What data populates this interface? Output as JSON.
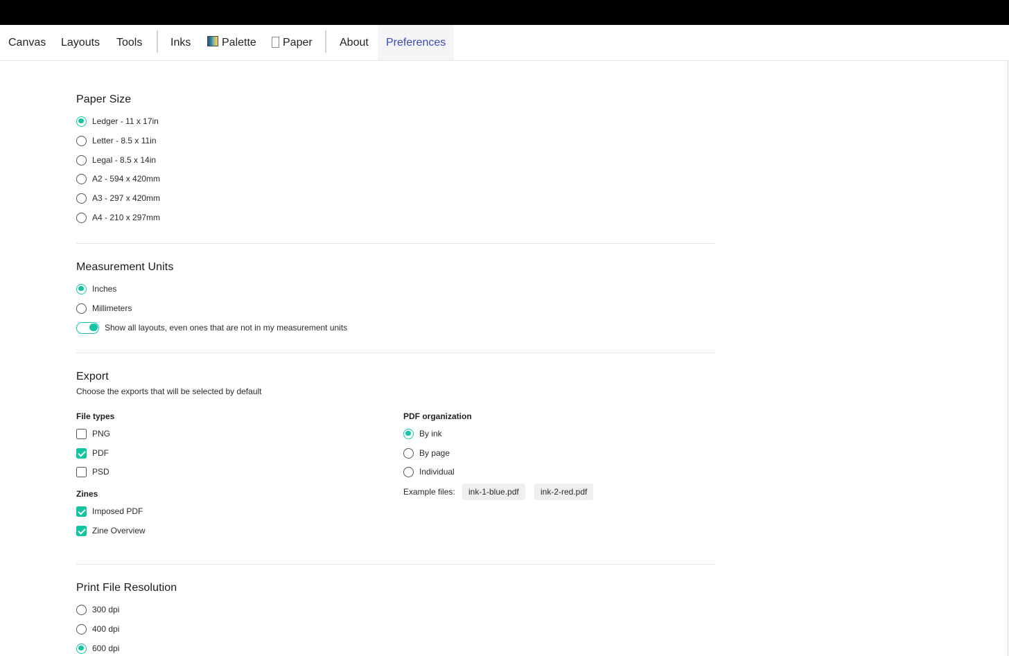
{
  "nav": {
    "items": [
      {
        "label": "Canvas"
      },
      {
        "label": "Layouts"
      },
      {
        "label": "Tools"
      },
      {
        "label": "Inks"
      },
      {
        "label": "Palette"
      },
      {
        "label": "Paper"
      },
      {
        "label": "About"
      },
      {
        "label": "Preferences",
        "active": true
      }
    ]
  },
  "paper_size": {
    "title": "Paper Size",
    "options": [
      {
        "label": "Ledger - 11 x 17in",
        "selected": true
      },
      {
        "label": "Letter - 8.5 x 11in",
        "selected": false
      },
      {
        "label": "Legal - 8.5 x 14in",
        "selected": false
      },
      {
        "label": "A2 - 594 x 420mm",
        "selected": false
      },
      {
        "label": "A3 - 297 x 420mm",
        "selected": false
      },
      {
        "label": "A4 - 210 x 297mm",
        "selected": false
      }
    ]
  },
  "measurement_units": {
    "title": "Measurement Units",
    "options": [
      {
        "label": "Inches",
        "selected": true
      },
      {
        "label": "Millimeters",
        "selected": false
      }
    ],
    "show_all_toggle": {
      "label": "Show all layouts, even ones that are not in my measurement units",
      "on": true
    }
  },
  "export": {
    "title": "Export",
    "subtitle": "Choose the exports that will be selected by default",
    "file_types": {
      "label": "File types",
      "options": [
        {
          "label": "PNG",
          "checked": false
        },
        {
          "label": "PDF",
          "checked": true
        },
        {
          "label": "PSD",
          "checked": false
        }
      ]
    },
    "zines": {
      "label": "Zines",
      "options": [
        {
          "label": "Imposed PDF",
          "checked": true
        },
        {
          "label": "Zine Overview",
          "checked": true
        }
      ]
    },
    "pdf_organization": {
      "label": "PDF organization",
      "options": [
        {
          "label": "By ink",
          "selected": true
        },
        {
          "label": "By page",
          "selected": false
        },
        {
          "label": "Individual",
          "selected": false
        }
      ],
      "example_label": "Example files:",
      "example_files": [
        "ink-1-blue.pdf",
        "ink-2-red.pdf"
      ]
    }
  },
  "print_resolution": {
    "title": "Print File Resolution",
    "options": [
      {
        "label": "300 dpi",
        "selected": false
      },
      {
        "label": "400 dpi",
        "selected": false
      },
      {
        "label": "600 dpi",
        "selected": true
      }
    ]
  },
  "colors": {
    "accent": "#13c4a3",
    "active_nav_text": "#3a49b8",
    "top_bar": "#000000"
  }
}
